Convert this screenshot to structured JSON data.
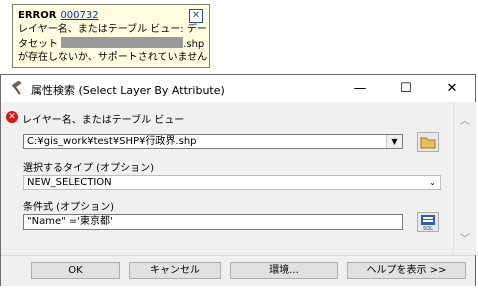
{
  "tooltip": {
    "error_label": "ERROR",
    "error_code": "000732",
    "close_glyph": "✕",
    "line1": "レイヤー名、またはテーブル ビュー: デー",
    "line2_prefix": "タセット",
    "line2_suffix": ".shp",
    "line3": "が存在しないか、サポートされていません"
  },
  "window": {
    "title": "属性検索 (Select Layer By Attribute)",
    "minimize": "—",
    "maximize": "☐",
    "close": "✕"
  },
  "form": {
    "layer_label": "レイヤー名、またはテーブル ビュー",
    "layer_value": "C:¥gis_work¥test¥SHP¥行政界.shp",
    "selection_type_label": "選択するタイプ (オプション)",
    "selection_type_value": "NEW_SELECTION",
    "expression_label": "条件式 (オプション)",
    "expression_value": "\"Name\" ='東京都'"
  },
  "buttons": {
    "ok": "OK",
    "cancel": "キャンセル",
    "environments": "環境...",
    "show_help": "ヘルプを表示 >>"
  },
  "colors": {
    "error_red": "#d8171b",
    "tooltip_bg": "#ffffe1",
    "link_blue": "#0033cc"
  }
}
